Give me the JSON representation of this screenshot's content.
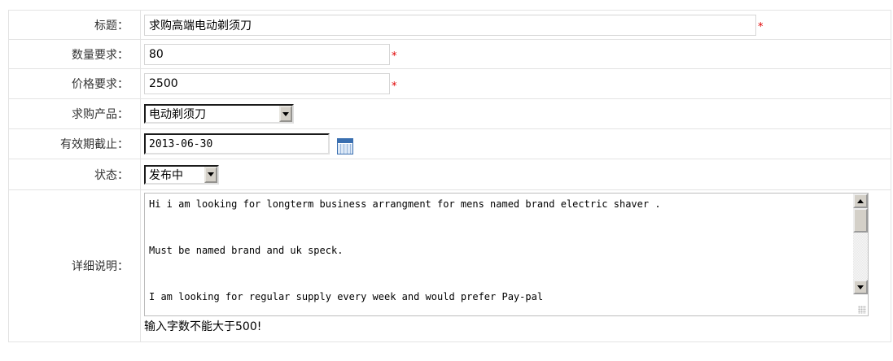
{
  "form": {
    "title": {
      "label": "标题：",
      "value": "求购高端电动剃须刀",
      "required_mark": "*"
    },
    "quantity": {
      "label": "数量要求：",
      "value": "80",
      "required_mark": "*"
    },
    "price": {
      "label": "价格要求：",
      "value": "2500",
      "required_mark": "*"
    },
    "product": {
      "label": "求购产品：",
      "selected": "电动剃须刀"
    },
    "expiry": {
      "label": "有效期截止：",
      "value": "2013-06-30"
    },
    "status": {
      "label": "状态：",
      "selected": "发布中"
    },
    "details": {
      "label": "详细说明：",
      "line1": "Hi i am looking for longterm business arrangment for mens named brand electric shaver .",
      "line2": "",
      "line3": "Must be named brand and uk speck.",
      "line4": "",
      "line5": "",
      "line6": "I am looking for regular supply every week and would prefer Pay-pal",
      "hint": "输入字数不能大于500!"
    }
  },
  "colors": {
    "required": "#e00000",
    "border": "#e3e3e3"
  },
  "icons": {
    "calendar": "calendar-icon",
    "dropdown": "chevron-down-icon",
    "scroll_up": "arrow-up-icon",
    "scroll_down": "arrow-down-icon"
  }
}
